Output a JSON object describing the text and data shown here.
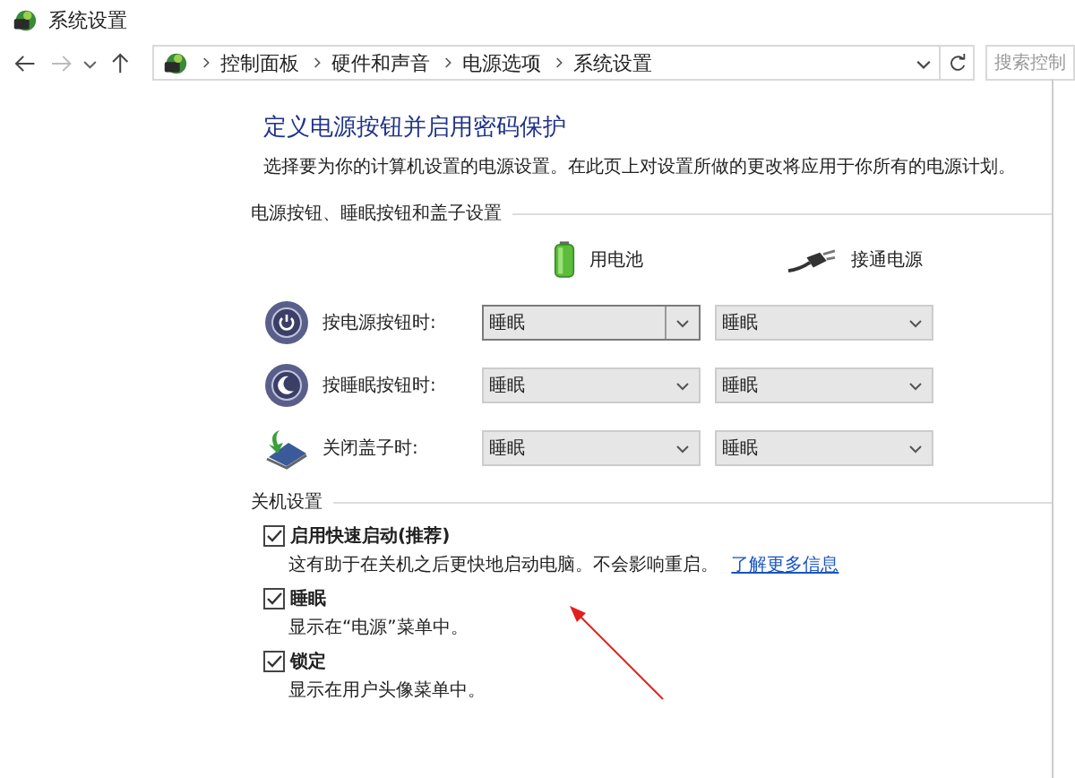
{
  "window": {
    "title": "系统设置"
  },
  "breadcrumb": [
    "控制面板",
    "硬件和声音",
    "电源选项",
    "系统设置"
  ],
  "search": {
    "placeholder": "搜索控制"
  },
  "heading": "定义电源按钮并启用密码保护",
  "description": "选择要为你的计算机设置的电源设置。在此页上对设置所做的更改将应用于你所有的电源计划。",
  "buttons_section": {
    "title": "电源按钮、睡眠按钮和盖子设置",
    "columns": [
      {
        "kind": "battery",
        "label": "用电池"
      },
      {
        "kind": "plug",
        "label": "接通电源"
      }
    ],
    "rows": [
      {
        "kind": "power",
        "label": "按电源按钮时:",
        "values": [
          {
            "value": "睡眠",
            "focused": true
          },
          {
            "value": "睡眠",
            "focused": false
          }
        ]
      },
      {
        "kind": "sleep",
        "label": "按睡眠按钮时:",
        "values": [
          {
            "value": "睡眠",
            "focused": false
          },
          {
            "value": "睡眠",
            "focused": false
          }
        ]
      },
      {
        "kind": "lid",
        "label": "关闭盖子时:",
        "values": [
          {
            "value": "睡眠",
            "focused": false
          },
          {
            "value": "睡眠",
            "focused": false
          }
        ]
      }
    ]
  },
  "shutdown_section": {
    "title": "关机设置",
    "options": [
      {
        "label": "启用快速启动(推荐)",
        "checked": true,
        "note": "这有助于在关机之后更快地启动电脑。不会影响重启。",
        "link": "了解更多信息"
      },
      {
        "label": "睡眠",
        "checked": true,
        "note": "显示在“电源”菜单中。"
      },
      {
        "label": "锁定",
        "checked": true,
        "note": "显示在用户头像菜单中。"
      }
    ]
  }
}
